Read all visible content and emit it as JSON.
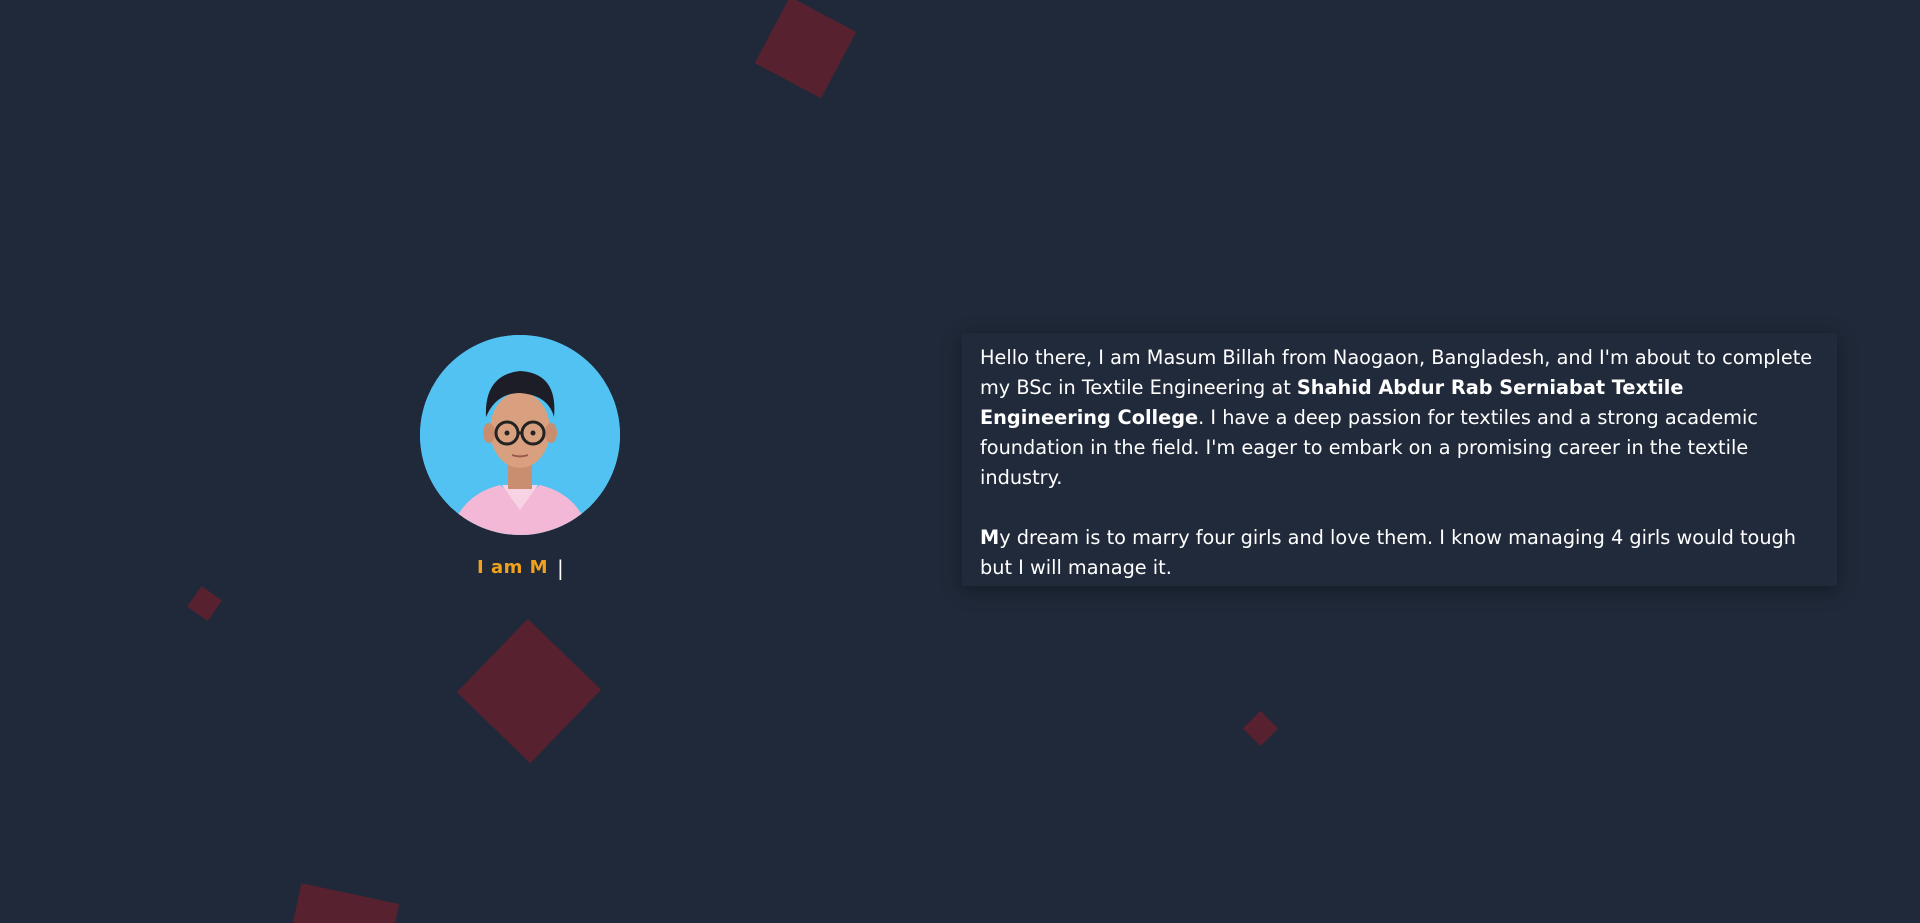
{
  "profile": {
    "typed_text": "I am M",
    "cursor": "|",
    "photo_icon": "person-portrait-icon"
  },
  "bio": {
    "p1_a": "Hello there, I am Masum Billah from Naogaon, Bangladesh, and I'm about to complete my BSc in Textile Engineering at ",
    "p1_college": "Shahid Abdur Rab Serniabat Textile Engineering College",
    "p1_b": ". I have a deep passion for textiles and a strong academic foundation in the field. I'm eager to embark on a promising career in the textile industry.",
    "p2_first_letter": "M",
    "p2_rest": "y dream is to marry four girls and love them. I know managing 4 girls would tough but I will manage it."
  },
  "colors": {
    "background": "#202939",
    "accent": "#f1a21c",
    "decor_square": "#58212f",
    "avatar_bg": "#52c2f2"
  }
}
